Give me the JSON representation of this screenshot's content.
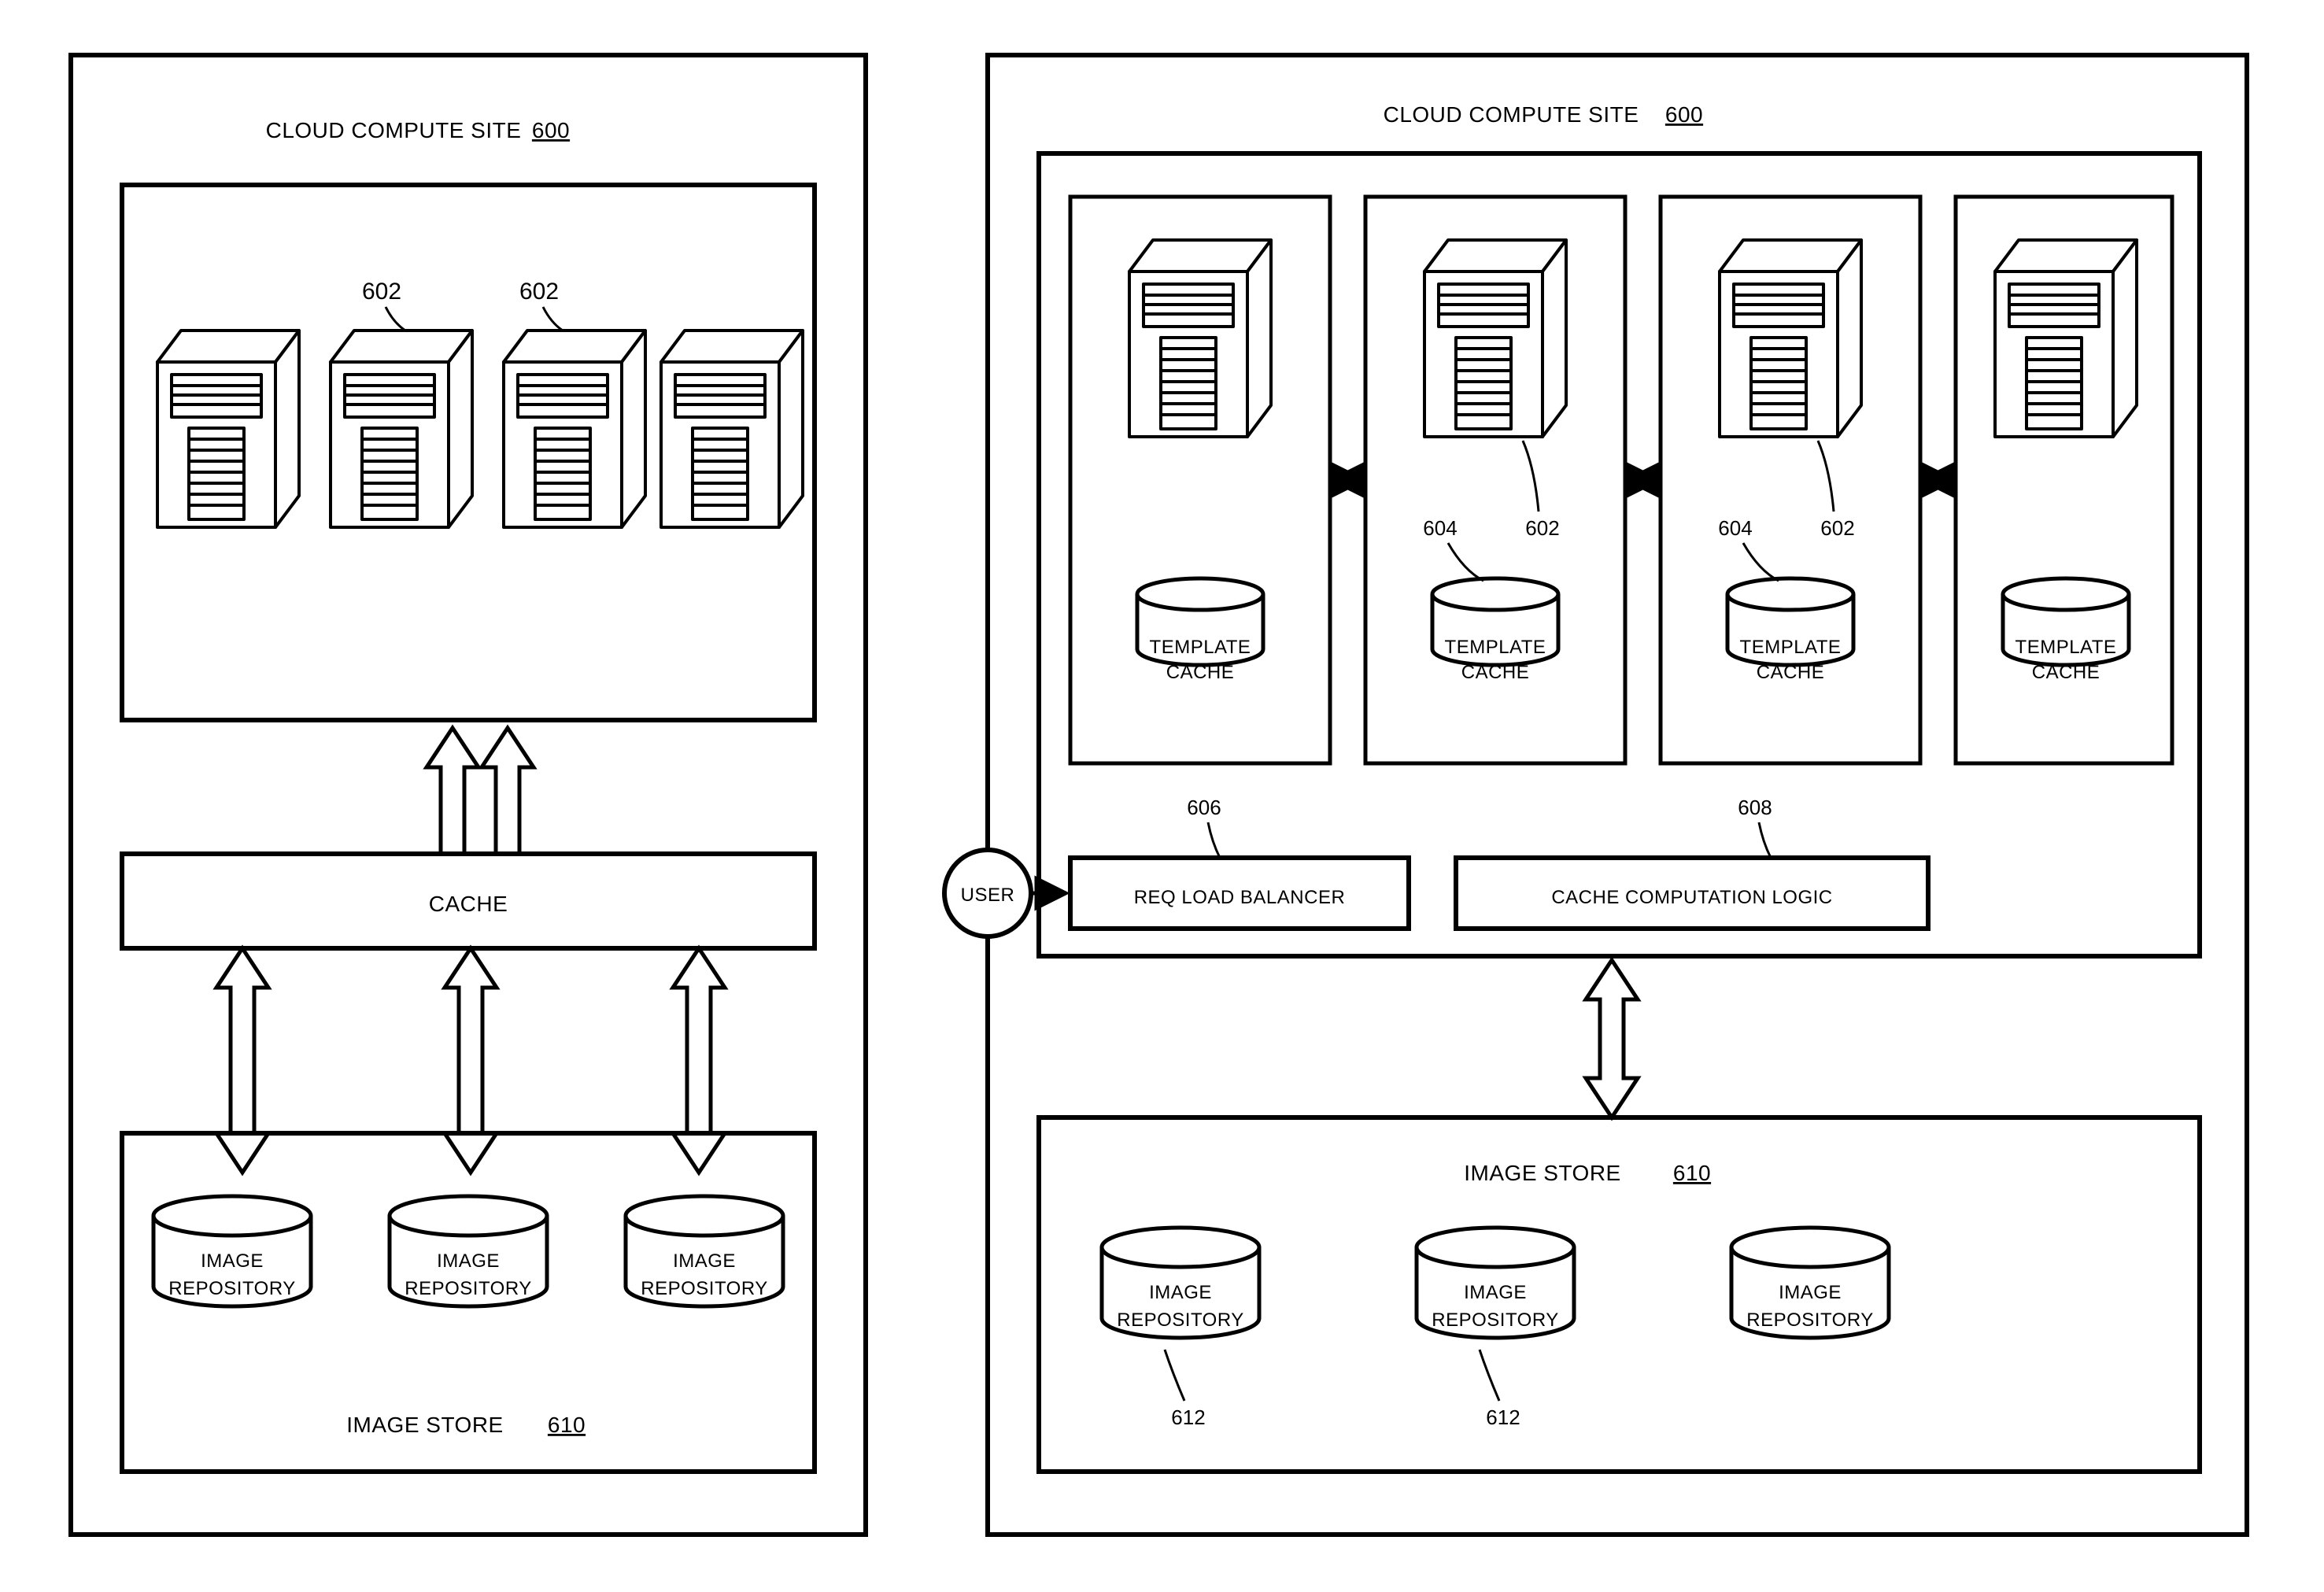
{
  "left": {
    "title": "CLOUD COMPUTE SITE",
    "title_num": "600",
    "server_label_1": "602",
    "server_label_2": "602",
    "cache": "CACHE",
    "imgstore_title": "IMAGE STORE",
    "imgstore_num": "610",
    "repo1a": "IMAGE",
    "repo1b": "REPOSITORY",
    "repo2a": "IMAGE",
    "repo2b": "REPOSITORY",
    "repo3a": "IMAGE",
    "repo3b": "REPOSITORY"
  },
  "right": {
    "title": "CLOUD COMPUTE SITE",
    "title_num": "600",
    "user": "USER",
    "tc_top": "TEMPLATE",
    "tc_bot": "CACHE",
    "lbl_604a": "604",
    "lbl_602a": "602",
    "lbl_604b": "604",
    "lbl_602b": "602",
    "lb_num": "606",
    "lb_label": "REQ LOAD BALANCER",
    "cc_num": "608",
    "cc_label": "CACHE COMPUTATION LOGIC",
    "imgstore_title": "IMAGE STORE",
    "imgstore_num": "610",
    "repo1a": "IMAGE",
    "repo1b": "REPOSITORY",
    "repo2a": "IMAGE",
    "repo2b": "REPOSITORY",
    "repo3a": "IMAGE",
    "repo3b": "REPOSITORY",
    "repo_lbl1": "612",
    "repo_lbl2": "612"
  }
}
